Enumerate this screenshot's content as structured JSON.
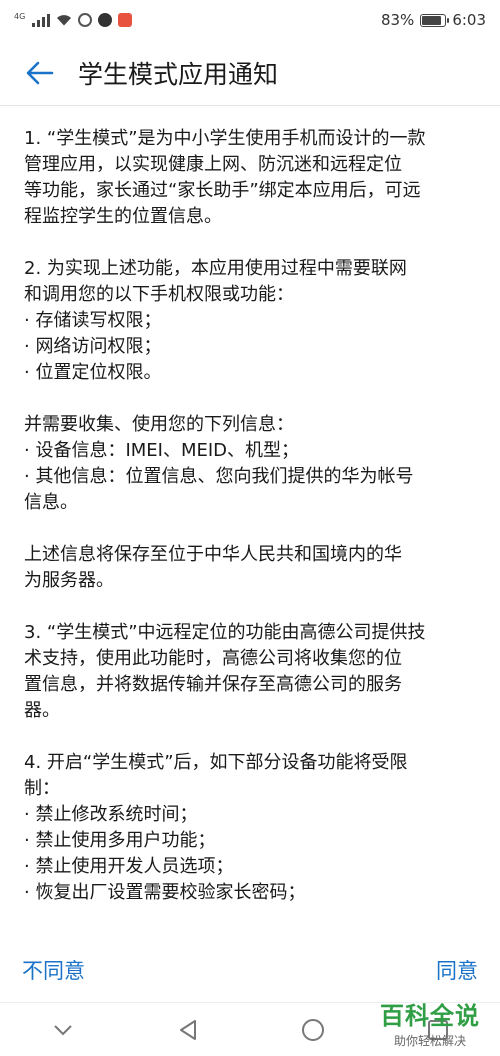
{
  "status_bar": {
    "network_type": "4G",
    "battery_percent": "83%",
    "time": "6:03",
    "battery_level": 0.83
  },
  "header": {
    "title": "学生模式应用通知"
  },
  "content": {
    "paragraphs": [
      [
        "1. “学生模式”是为中小学生使用手机而设计的一款",
        "管理应用，以实现健康上网、防沉迷和远程定位",
        "等功能，家长通过“家长助手”绑定本应用后，可远",
        "程监控学生的位置信息。"
      ],
      [
        "2. 为实现上述功能，本应用使用过程中需要联网",
        "和调用您的以下手机权限或功能：",
        "· 存储读写权限；",
        "· 网络访问权限；",
        "· 位置定位权限。"
      ],
      [
        "并需要收集、使用您的下列信息：",
        "· 设备信息：IMEI、MEID、机型；",
        "· 其他信息：位置信息、您向我们提供的华为帐号",
        "信息。"
      ],
      [
        "上述信息将保存至位于中华人民共和国境内的华",
        "为服务器。"
      ],
      [
        "3. “学生模式”中远程定位的功能由高德公司提供技",
        "术支持，使用此功能时，高德公司将收集您的位",
        "置信息，并将数据传输并保存至高德公司的服务",
        "器。"
      ],
      [
        "4. 开启“学生模式”后，如下部分设备功能将受限",
        "制：",
        "· 禁止修改系统时间；",
        "· 禁止使用多用户功能；",
        "· 禁止使用开发人员选项；",
        "· 恢复出厂设置需要校验家长密码；"
      ]
    ]
  },
  "actions": {
    "disagree_label": "不同意",
    "agree_label": "同意"
  },
  "watermark": {
    "main": "百科全说",
    "sub": "助你轻松解决"
  },
  "colors": {
    "accent": "#1a73c8",
    "watermark_green": "#2f9e44"
  }
}
